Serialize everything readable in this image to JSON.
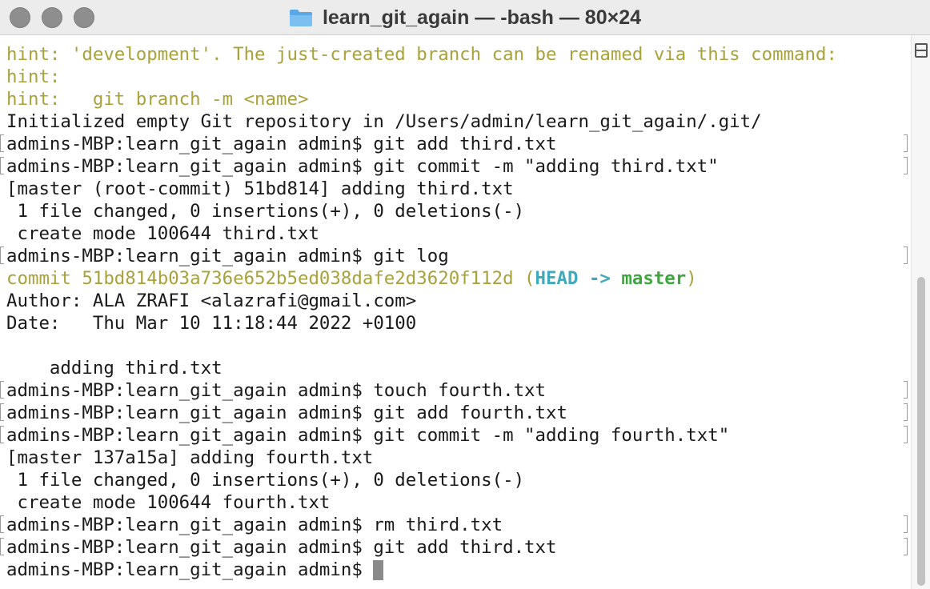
{
  "window": {
    "title": "learn_git_again — -bash — 80×24"
  },
  "terminal": {
    "lines": {
      "l1": "hint: 'development'. The just-created branch can be renamed via this command:",
      "l2": "hint:",
      "l3": "hint:   git branch -m <name>",
      "l4": "Initialized empty Git repository in /Users/admin/learn_git_again/.git/",
      "l5": "admins-MBP:learn_git_again admin$ git add third.txt",
      "l6": "admins-MBP:learn_git_again admin$ git commit -m \"adding third.txt\"",
      "l7": "[master (root-commit) 51bd814] adding third.txt",
      "l8": " 1 file changed, 0 insertions(+), 0 deletions(-)",
      "l9": " create mode 100644 third.txt",
      "l10": "admins-MBP:learn_git_again admin$ git log",
      "l11_commit": "commit 51bd814b03a736e652b5ed038dafe2d3620f112d (",
      "l11_head": "HEAD -> ",
      "l11_branch": "master",
      "l11_close": ")",
      "l12": "Author: ALA ZRAFI <alazrafi@gmail.com>",
      "l13": "Date:   Thu Mar 10 11:18:44 2022 +0100",
      "l14": "",
      "l15": "    adding third.txt",
      "l16": "admins-MBP:learn_git_again admin$ touch fourth.txt",
      "l17": "admins-MBP:learn_git_again admin$ git add fourth.txt",
      "l18": "admins-MBP:learn_git_again admin$ git commit -m \"adding fourth.txt\"",
      "l19": "[master 137a15a] adding fourth.txt",
      "l20": " 1 file changed, 0 insertions(+), 0 deletions(-)",
      "l21": " create mode 100644 fourth.txt",
      "l22": "admins-MBP:learn_git_again admin$ rm third.txt",
      "l23": "admins-MBP:learn_git_again admin$ git add third.txt",
      "l24": "admins-MBP:learn_git_again admin$ "
    }
  },
  "colors": {
    "hint": "#a9a13a",
    "head": "#3fa9bd",
    "branch": "#3ea63e"
  },
  "icons": {
    "title_icon": "folder-icon",
    "scroll_icon": "split-pane-icon"
  }
}
